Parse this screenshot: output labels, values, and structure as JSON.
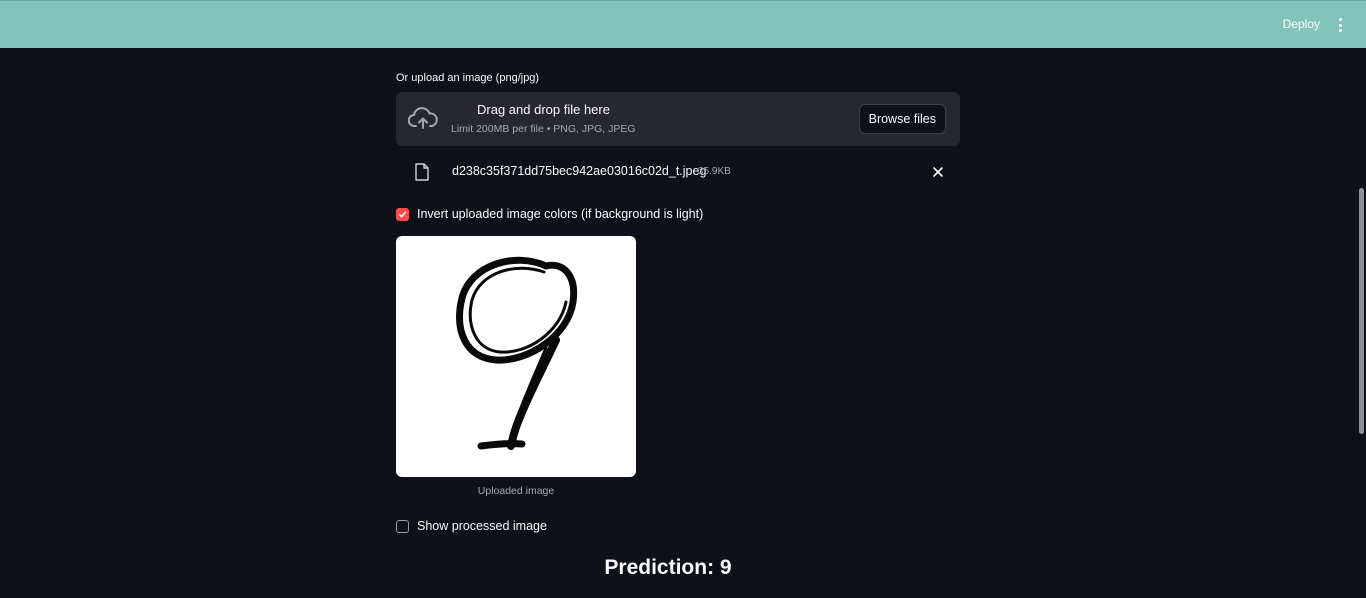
{
  "header": {
    "deploy_label": "Deploy",
    "menu_icon": "kebab-menu-icon"
  },
  "uploader": {
    "label": "Or upload an image (png/jpg)",
    "title": "Drag and drop file here",
    "limit": "Limit 200MB per file • PNG, JPG, JPEG",
    "browse_label": "Browse files",
    "icon": "cloud-upload-icon"
  },
  "file": {
    "name": "d238c35f371dd75bec942ae03016c02d_t.jpeg",
    "size": "35.9KB",
    "icon": "file-icon",
    "remove_icon": "close-icon"
  },
  "invert_checkbox": {
    "label": "Invert uploaded image colors (if background is light)",
    "checked": true
  },
  "image": {
    "caption": "Uploaded image"
  },
  "processed_checkbox": {
    "label": "Show processed image",
    "checked": false
  },
  "prediction": {
    "text": "Prediction: 9"
  },
  "colors": {
    "header_bg": "#82c4bc",
    "page_bg": "#0e1117",
    "accent": "#ff4b4b",
    "dropzone_bg": "#262730"
  }
}
